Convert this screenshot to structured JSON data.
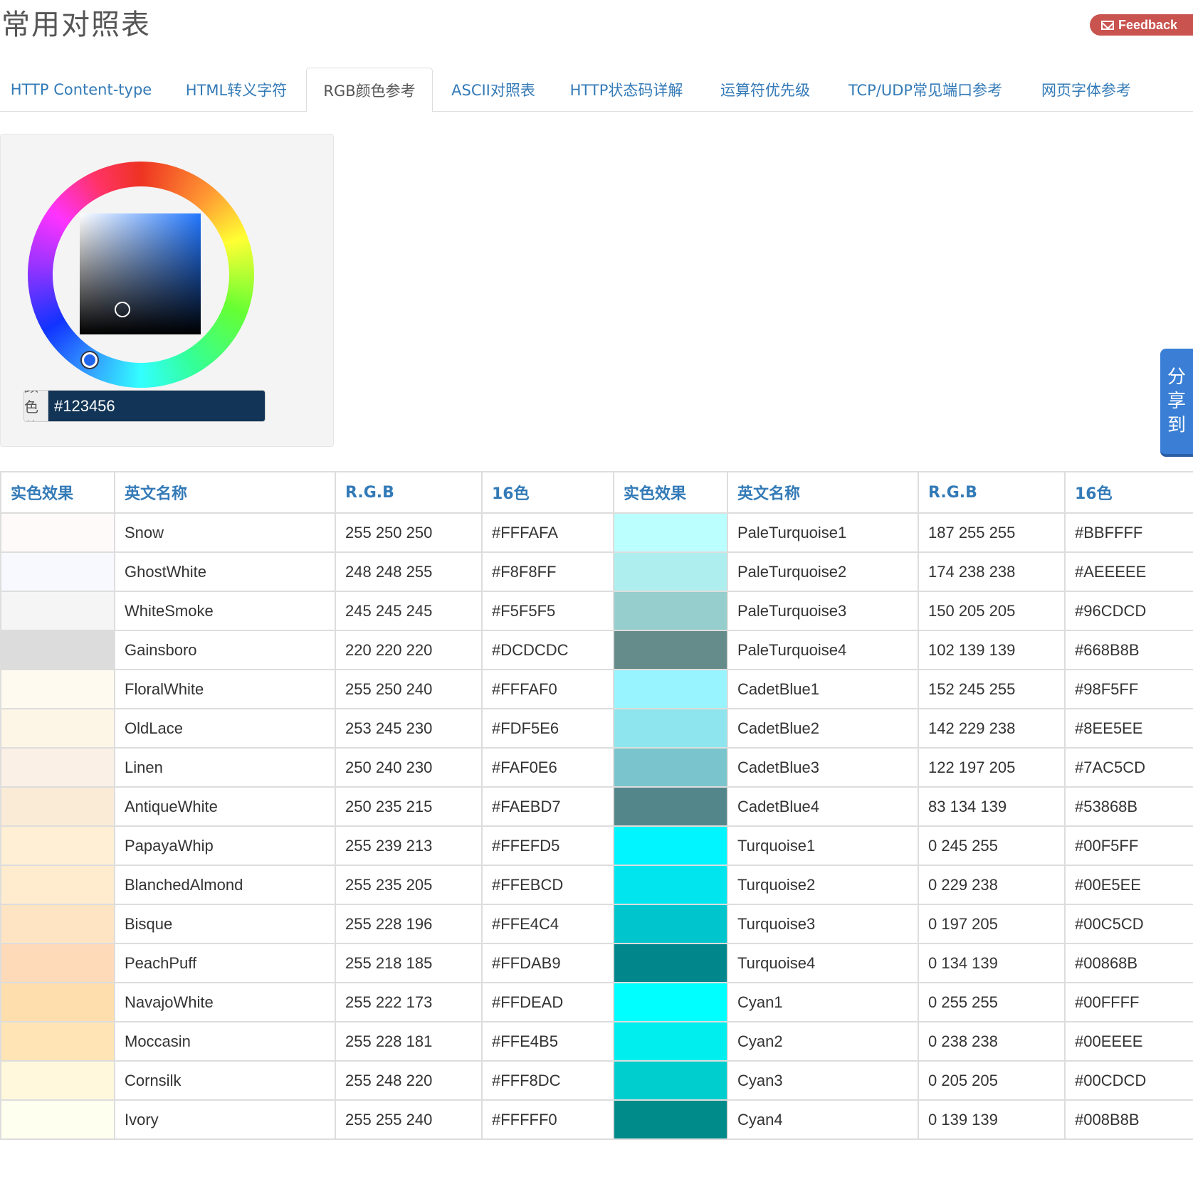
{
  "page": {
    "title": "常用对照表",
    "feedback_label": "Feedback"
  },
  "tabs": [
    {
      "label": "HTTP Content-type"
    },
    {
      "label": "HTML转义字符"
    },
    {
      "label": "RGB颜色参考"
    },
    {
      "label": "ASCII对照表"
    },
    {
      "label": "HTTP状态码详解"
    },
    {
      "label": "运算符优先级"
    },
    {
      "label": "TCP/UDP常见端口参考"
    },
    {
      "label": "网页字体参考"
    }
  ],
  "active_tab": "RGB颜色参考",
  "picker": {
    "label": "颜色值:",
    "value": "#123456"
  },
  "share": {
    "label": [
      "分",
      "享",
      "到"
    ]
  },
  "table": {
    "headers": [
      "实色效果",
      "英文名称",
      "R.G.B",
      "16色",
      "实色效果",
      "英文名称",
      "R.G.B",
      "16色"
    ],
    "rows": [
      [
        {
          "name": "Snow",
          "rgb": "255 250 250",
          "hex": "#FFFAFA"
        },
        {
          "name": "PaleTurquoise1",
          "rgb": "187 255 255",
          "hex": "#BBFFFF"
        }
      ],
      [
        {
          "name": "GhostWhite",
          "rgb": "248 248 255",
          "hex": "#F8F8FF"
        },
        {
          "name": "PaleTurquoise2",
          "rgb": "174 238 238",
          "hex": "#AEEEEE"
        }
      ],
      [
        {
          "name": "WhiteSmoke",
          "rgb": "245 245 245",
          "hex": "#F5F5F5"
        },
        {
          "name": "PaleTurquoise3",
          "rgb": "150 205 205",
          "hex": "#96CDCD"
        }
      ],
      [
        {
          "name": "Gainsboro",
          "rgb": "220 220 220",
          "hex": "#DCDCDC"
        },
        {
          "name": "PaleTurquoise4",
          "rgb": "102 139 139",
          "hex": "#668B8B"
        }
      ],
      [
        {
          "name": "FloralWhite",
          "rgb": "255 250 240",
          "hex": "#FFFAF0"
        },
        {
          "name": "CadetBlue1",
          "rgb": "152 245 255",
          "hex": "#98F5FF"
        }
      ],
      [
        {
          "name": "OldLace",
          "rgb": "253 245 230",
          "hex": "#FDF5E6"
        },
        {
          "name": "CadetBlue2",
          "rgb": "142 229 238",
          "hex": "#8EE5EE"
        }
      ],
      [
        {
          "name": "Linen",
          "rgb": "250 240 230",
          "hex": "#FAF0E6"
        },
        {
          "name": "CadetBlue3",
          "rgb": "122 197 205",
          "hex": "#7AC5CD"
        }
      ],
      [
        {
          "name": "AntiqueWhite",
          "rgb": "250 235 215",
          "hex": "#FAEBD7"
        },
        {
          "name": "CadetBlue4",
          "rgb": "83 134 139",
          "hex": "#53868B"
        }
      ],
      [
        {
          "name": "PapayaWhip",
          "rgb": "255 239 213",
          "hex": "#FFEFD5"
        },
        {
          "name": "Turquoise1",
          "rgb": "0 245 255",
          "hex": "#00F5FF"
        }
      ],
      [
        {
          "name": "BlanchedAlmond",
          "rgb": "255 235 205",
          "hex": "#FFEBCD"
        },
        {
          "name": "Turquoise2",
          "rgb": "0 229 238",
          "hex": "#00E5EE"
        }
      ],
      [
        {
          "name": "Bisque",
          "rgb": "255 228 196",
          "hex": "#FFE4C4"
        },
        {
          "name": "Turquoise3",
          "rgb": "0 197 205",
          "hex": "#00C5CD"
        }
      ],
      [
        {
          "name": "PeachPuff",
          "rgb": "255 218 185",
          "hex": "#FFDAB9"
        },
        {
          "name": "Turquoise4",
          "rgb": "0 134 139",
          "hex": "#00868B"
        }
      ],
      [
        {
          "name": "NavajoWhite",
          "rgb": "255 222 173",
          "hex": "#FFDEAD"
        },
        {
          "name": "Cyan1",
          "rgb": "0 255 255",
          "hex": "#00FFFF"
        }
      ],
      [
        {
          "name": "Moccasin",
          "rgb": "255 228 181",
          "hex": "#FFE4B5"
        },
        {
          "name": "Cyan2",
          "rgb": "0 238 238",
          "hex": "#00EEEE"
        }
      ],
      [
        {
          "name": "Cornsilk",
          "rgb": "255 248 220",
          "hex": "#FFF8DC"
        },
        {
          "name": "Cyan3",
          "rgb": "0 205 205",
          "hex": "#00CDCD"
        }
      ],
      [
        {
          "name": "Ivory",
          "rgb": "255 255 240",
          "hex": "#FFFFF0"
        },
        {
          "name": "Cyan4",
          "rgb": "0 139 139",
          "hex": "#008B8B"
        }
      ]
    ]
  }
}
